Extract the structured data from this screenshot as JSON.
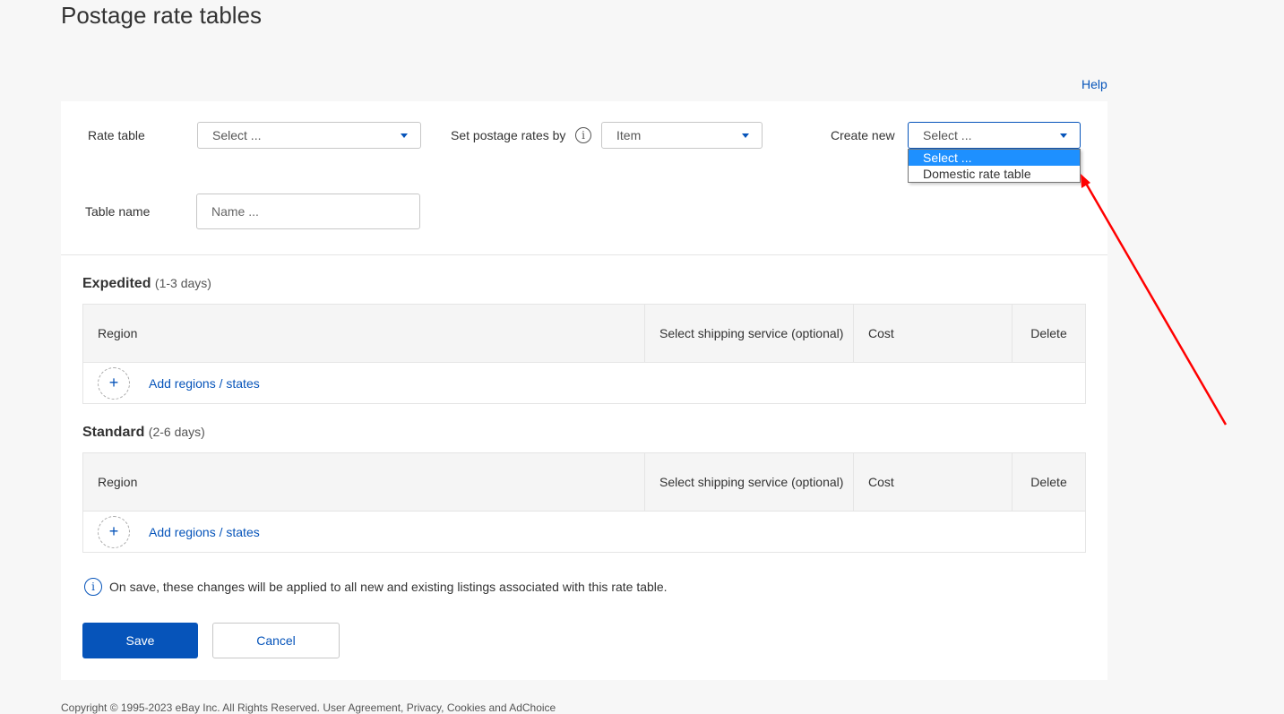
{
  "page": {
    "title": "Postage rate tables",
    "help_label": "Help"
  },
  "form": {
    "rate_table": {
      "label": "Rate table",
      "value": "Select ..."
    },
    "set_rates_by": {
      "label": "Set postage rates by",
      "value": "Item",
      "info_icon": "info-icon"
    },
    "create_new": {
      "label": "Create new",
      "value": "Select ...",
      "options": [
        {
          "label": "Select ...",
          "selected": true
        },
        {
          "label": "Domestic rate table",
          "selected": false
        }
      ]
    },
    "table_name": {
      "label": "Table name",
      "placeholder": "Name ...",
      "value": ""
    }
  },
  "sections": [
    {
      "title": "Expedited",
      "subtitle": "(1-3 days)",
      "columns": [
        "Region",
        "Select shipping service (optional)",
        "Cost",
        "Delete"
      ],
      "add_label": "Add regions / states"
    },
    {
      "title": "Standard",
      "subtitle": "(2-6 days)",
      "columns": [
        "Region",
        "Select shipping service (optional)",
        "Cost",
        "Delete"
      ],
      "add_label": "Add regions / states"
    }
  ],
  "notice": {
    "text": "On save, these changes will be applied to all new and existing listings associated with this rate table."
  },
  "actions": {
    "save_label": "Save",
    "cancel_label": "Cancel"
  },
  "footer": {
    "text": "Copyright © 1995-2023 eBay Inc. All Rights Reserved. User Agreement, Privacy, Cookies and AdChoice"
  },
  "annotation": {
    "color": "#ff0000",
    "type": "arrow",
    "points_to": "create-new-dropdown-list"
  },
  "colors": {
    "accent": "#0654ba",
    "selected_option": "#1e90ff",
    "background": "#f7f7f7"
  }
}
